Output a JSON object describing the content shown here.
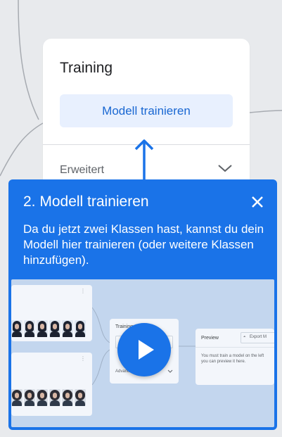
{
  "training": {
    "title": "Training",
    "train_button_label": "Modell trainieren",
    "advanced_label": "Erweitert",
    "chevron_icon": "chevron-down-icon"
  },
  "arrow_icon": "arrow-up-icon",
  "tutorial": {
    "title": "2. Modell trainieren",
    "close_icon": "close-icon",
    "text": "Da du jetzt zwei Klassen hast, kannst du dein Modell hier trainieren (oder weitere Klassen hinzufügen).",
    "video": {
      "play_icon": "play-icon",
      "training_title": "Training",
      "advanced_label": "Advanced",
      "preview_title": "Preview",
      "export_label": "Export M",
      "preview_text_1": "You must train a model on the left",
      "preview_text_2": "you can preview it here."
    }
  },
  "colors": {
    "accent": "#1a73e8",
    "button_bg": "#e8f0fe",
    "button_text": "#1967d2",
    "background": "#e8eaed"
  }
}
